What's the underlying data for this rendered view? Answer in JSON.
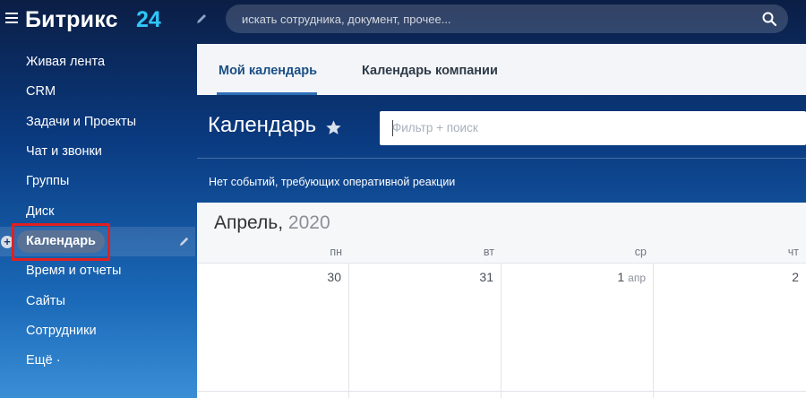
{
  "header": {
    "logo_text": "Битрикс",
    "logo_number": "24",
    "search_placeholder": "искать сотрудника, документ, прочее..."
  },
  "sidebar": {
    "items": [
      {
        "label": "Живая лента"
      },
      {
        "label": "CRM"
      },
      {
        "label": "Задачи и Проекты"
      },
      {
        "label": "Чат и звонки"
      },
      {
        "label": "Группы"
      },
      {
        "label": "Диск"
      },
      {
        "label": "Календарь",
        "active": true
      },
      {
        "label": "Время и отчеты"
      },
      {
        "label": "Сайты"
      },
      {
        "label": "Сотрудники"
      },
      {
        "label": "Ещё ·"
      }
    ],
    "plus_symbol": "+"
  },
  "tabs": [
    {
      "label": "Мой календарь",
      "active": true
    },
    {
      "label": "Календарь компании",
      "active": false
    }
  ],
  "page": {
    "title": "Календарь",
    "filter_placeholder": "Фильтр + поиск",
    "no_events": "Нет событий, требующих оперативной реакции"
  },
  "calendar": {
    "month": "Апрель,",
    "year": "2020",
    "weekdays": [
      "пн",
      "вт",
      "ср",
      "чт"
    ],
    "days": [
      {
        "num": "30",
        "month": ""
      },
      {
        "num": "31",
        "month": ""
      },
      {
        "num": "1",
        "month": "апр"
      },
      {
        "num": "2",
        "month": ""
      }
    ]
  },
  "colors": {
    "accent": "#2fc7f7",
    "active_pill": "#587195",
    "highlight_box": "#e02020",
    "tab_underline": "#2e6fb6"
  }
}
